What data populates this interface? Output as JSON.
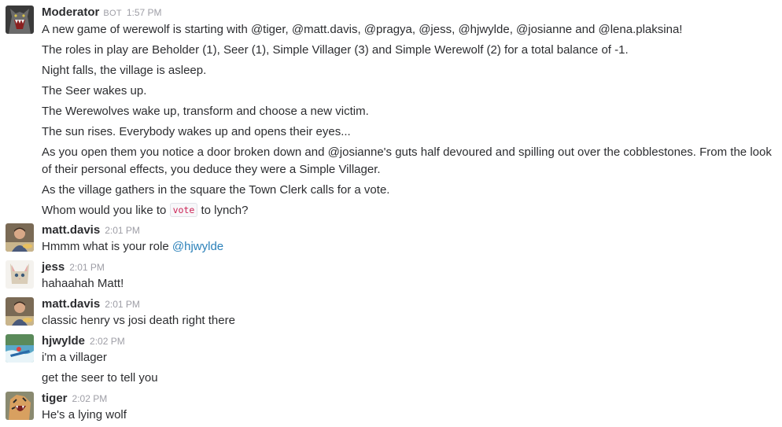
{
  "messages": [
    {
      "author": "Moderator",
      "badge": "BOT",
      "time": "1:57 PM",
      "lines": [
        "A new game of werewolf is starting with @tiger, @matt.davis, @pragya, @jess, @hjwylde, @josianne and @lena.plaksina!",
        "The roles in play are Beholder (1), Seer (1), Simple Villager (3) and Simple Werewolf (2) for a total balance of -1.",
        "Night falls, the village is asleep.",
        "The Seer wakes up.",
        "The Werewolves wake up, transform and choose a new victim.",
        "The sun rises. Everybody wakes up and opens their eyes...",
        "As you open them you notice a door broken down and @josianne's guts half devoured and spilling out over the cobblestones. From the look of their personal effects, you deduce they were a Simple Villager.",
        "As the village gathers in the square the Town Clerk calls for a vote."
      ],
      "vote_line": {
        "before": "Whom would you like to ",
        "code": "vote",
        "after": " to lynch?"
      }
    },
    {
      "author": "matt.davis",
      "time": "2:01 PM",
      "text_before": "Hmmm what is your role ",
      "mention": "@hjwylde"
    },
    {
      "author": "jess",
      "time": "2:01 PM",
      "text": "hahaahah Matt!"
    },
    {
      "author": "matt.davis",
      "time": "2:01 PM",
      "text": "classic henry vs josi death right there"
    },
    {
      "author": "hjwylde",
      "time": "2:02 PM",
      "lines": [
        "i'm a villager",
        "get the seer to tell you"
      ]
    },
    {
      "author": "tiger",
      "time": "2:02 PM",
      "text": "He's a lying wolf"
    }
  ],
  "colors": {
    "mention": "#2a80b9",
    "code": "#cc2255",
    "timestamp": "#9e9ea6"
  },
  "icons": [
    "wolf-avatar-icon",
    "matt-avatar-icon",
    "cat-avatar-icon",
    "river-avatar-icon",
    "tiger-avatar-icon"
  ]
}
